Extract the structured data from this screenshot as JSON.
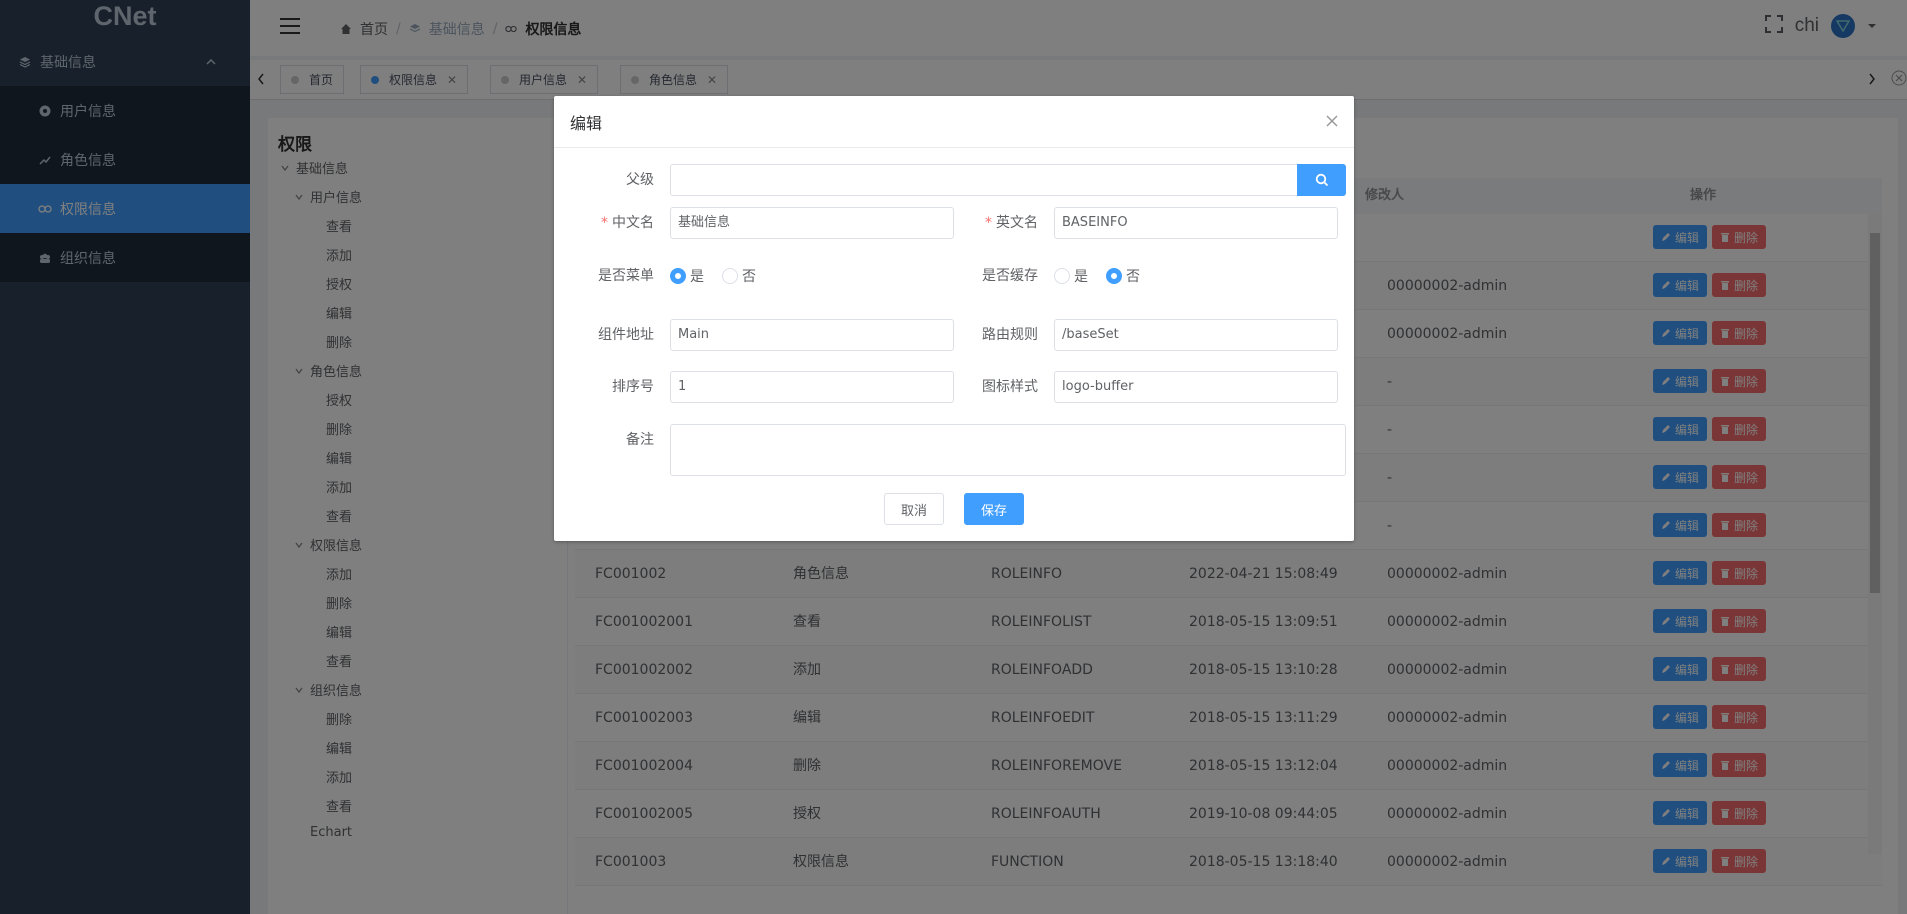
{
  "app": {
    "brand": "CNet"
  },
  "sidebar": {
    "group": {
      "label": "基础信息",
      "icon": "layers-icon"
    },
    "items": [
      {
        "label": "用户信息",
        "icon": "user-circle-icon",
        "active": false
      },
      {
        "label": "角色信息",
        "icon": "trend-icon",
        "active": false
      },
      {
        "label": "权限信息",
        "icon": "link-icon",
        "active": true
      },
      {
        "label": "组织信息",
        "icon": "team-icon",
        "active": false
      }
    ]
  },
  "navbar": {
    "breadcrumb": [
      {
        "label": "首页",
        "icon": "home-icon"
      },
      {
        "label": "基础信息",
        "icon": "layers-icon"
      },
      {
        "label": "权限信息",
        "icon": "link-icon"
      }
    ],
    "user": "chi"
  },
  "tags": [
    {
      "label": "首页",
      "closable": false,
      "active": false
    },
    {
      "label": "权限信息",
      "closable": true,
      "active": true
    },
    {
      "label": "用户信息",
      "closable": true,
      "active": false
    },
    {
      "label": "角色信息",
      "closable": true,
      "active": false
    }
  ],
  "tree": {
    "title": "权限",
    "nodes": [
      {
        "label": "基础信息",
        "level": 0,
        "expanded": true
      },
      {
        "label": "用户信息",
        "level": 1,
        "expanded": true
      },
      {
        "label": "查看",
        "level": 2
      },
      {
        "label": "添加",
        "level": 2
      },
      {
        "label": "授权",
        "level": 2
      },
      {
        "label": "编辑",
        "level": 2
      },
      {
        "label": "删除",
        "level": 2
      },
      {
        "label": "角色信息",
        "level": 1,
        "expanded": true
      },
      {
        "label": "授权",
        "level": 2
      },
      {
        "label": "删除",
        "level": 2
      },
      {
        "label": "编辑",
        "level": 2
      },
      {
        "label": "添加",
        "level": 2
      },
      {
        "label": "查看",
        "level": 2
      },
      {
        "label": "权限信息",
        "level": 1,
        "expanded": true
      },
      {
        "label": "添加",
        "level": 2
      },
      {
        "label": "删除",
        "level": 2
      },
      {
        "label": "编辑",
        "level": 2
      },
      {
        "label": "查看",
        "level": 2
      },
      {
        "label": "组织信息",
        "level": 1,
        "expanded": true
      },
      {
        "label": "删除",
        "level": 2
      },
      {
        "label": "编辑",
        "level": 2
      },
      {
        "label": "添加",
        "level": 2
      },
      {
        "label": "查看",
        "level": 2
      },
      {
        "label": "Echart",
        "level": 1
      }
    ]
  },
  "table": {
    "headers": {
      "modifier": "修改人",
      "ops": "操作"
    },
    "edit_label": "编辑",
    "delete_label": "删除",
    "rows": [
      {
        "code": "",
        "name": "",
        "en": "",
        "time": "",
        "modifier": ""
      },
      {
        "code": "",
        "name": "",
        "en": "",
        "time": "",
        "modifier": "00000002-admin"
      },
      {
        "code": "",
        "name": "",
        "en": "",
        "time": "",
        "modifier": "00000002-admin"
      },
      {
        "code": "",
        "name": "",
        "en": "",
        "time": "",
        "modifier": "-"
      },
      {
        "code": "",
        "name": "",
        "en": "",
        "time": "",
        "modifier": "-"
      },
      {
        "code": "",
        "name": "",
        "en": "",
        "time": "",
        "modifier": "-"
      },
      {
        "code": "",
        "name": "",
        "en": "",
        "time": "",
        "modifier": "-"
      },
      {
        "code": "FC001002",
        "name": "角色信息",
        "en": "ROLEINFO",
        "time": "2022-04-21 15:08:49",
        "modifier": "00000002-admin"
      },
      {
        "code": "FC001002001",
        "name": "查看",
        "en": "ROLEINFOLIST",
        "time": "2018-05-15 13:09:51",
        "modifier": "00000002-admin"
      },
      {
        "code": "FC001002002",
        "name": "添加",
        "en": "ROLEINFOADD",
        "time": "2018-05-15 13:10:28",
        "modifier": "00000002-admin"
      },
      {
        "code": "FC001002003",
        "name": "编辑",
        "en": "ROLEINFOEDIT",
        "time": "2018-05-15 13:11:29",
        "modifier": "00000002-admin"
      },
      {
        "code": "FC001002004",
        "name": "删除",
        "en": "ROLEINFOREMOVE",
        "time": "2018-05-15 13:12:04",
        "modifier": "00000002-admin"
      },
      {
        "code": "FC001002005",
        "name": "授权",
        "en": "ROLEINFOAUTH",
        "time": "2019-10-08 09:44:05",
        "modifier": "00000002-admin"
      },
      {
        "code": "FC001003",
        "name": "权限信息",
        "en": "FUNCTION",
        "time": "2018-05-15 13:18:40",
        "modifier": "00000002-admin"
      }
    ]
  },
  "dialog": {
    "title": "编辑",
    "parent_label": "父级",
    "parent_value": "",
    "cn_name_label": "中文名",
    "cn_name_value": "基础信息",
    "en_name_label": "英文名",
    "en_name_value": "BASEINFO",
    "is_menu_label": "是否菜单",
    "is_cache_label": "是否缓存",
    "yes": "是",
    "no": "否",
    "is_menu": "是",
    "is_cache": "否",
    "component_label": "组件地址",
    "component_value": "Main",
    "route_label": "路由规则",
    "route_value": "/baseSet",
    "order_label": "排序号",
    "order_value": "1",
    "icon_label": "图标样式",
    "icon_value": "logo-buffer",
    "remark_label": "备注",
    "remark_value": "",
    "cancel": "取消",
    "save": "保存"
  }
}
